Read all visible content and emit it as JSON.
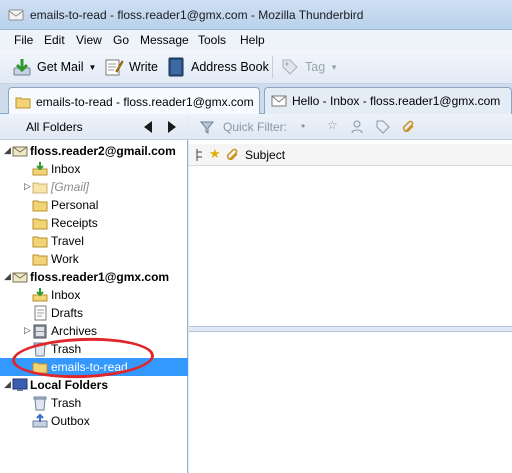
{
  "window": {
    "title": "emails-to-read - floss.reader1@gmx.com - Mozilla Thunderbird"
  },
  "menu": [
    "File",
    "Edit",
    "View",
    "Go",
    "Message",
    "Tools",
    "Help"
  ],
  "toolbar": {
    "get_mail": "Get Mail",
    "write": "Write",
    "address_book": "Address Book",
    "tag": "Tag"
  },
  "tabs": [
    {
      "label": "emails-to-read - floss.reader1@gmx.com",
      "active": true,
      "icon": "folder-icon"
    },
    {
      "label": "Hello - Inbox - floss.reader1@gmx.com",
      "active": false,
      "icon": "envelope-icon"
    }
  ],
  "folder_pane": {
    "header": "All Folders",
    "accounts": [
      {
        "name": "floss.reader2@gmail.com",
        "folders": [
          "Inbox",
          "[Gmail]",
          "Personal",
          "Receipts",
          "Travel",
          "Work"
        ]
      },
      {
        "name": "floss.reader1@gmx.com",
        "folders": [
          "Inbox",
          "Drafts",
          "Archives",
          "Trash",
          "emails-to-read"
        ]
      },
      {
        "name": "Local Folders",
        "folders": [
          "Trash",
          "Outbox"
        ]
      }
    ],
    "selected_folder": "emails-to-read"
  },
  "quick_filter": {
    "label": "Quick Filter:"
  },
  "thread_columns": {
    "subject": "Subject"
  },
  "colors": {
    "selection": "#3399ff",
    "annotation": "#e0262b",
    "accent": "#1c5fae"
  }
}
